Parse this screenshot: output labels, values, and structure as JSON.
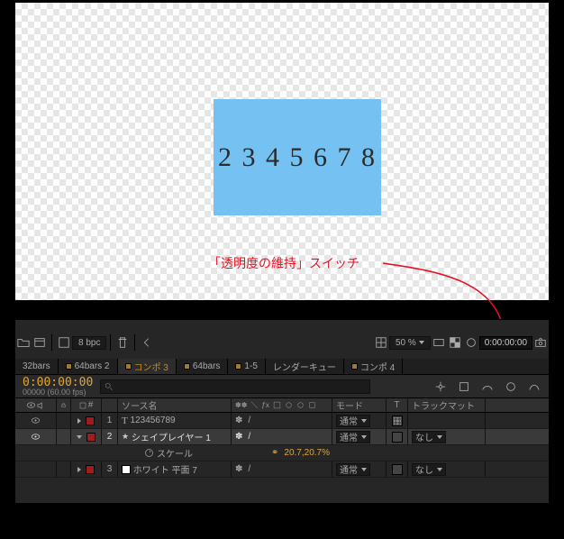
{
  "preview": {
    "numbers_visible": "2 3 4 5 6 7 8"
  },
  "annotation": {
    "text": "「透明度の維持」スイッチ"
  },
  "project_bar": {
    "bpc_label": "8 bpc",
    "zoom": "50 %",
    "timecode": "0:00:00:00"
  },
  "timeline": {
    "tabs": [
      "32bars",
      "64bars 2",
      "コンポ 3",
      "64bars",
      "1-5",
      "レンダーキュー",
      "コンポ 4"
    ],
    "selected_tab": 2,
    "timecode": "0:00:00:00",
    "frame_label": "00000 (60.00 fps)",
    "search_placeholder": "",
    "columns": {
      "source_name": "ソース名",
      "mode": "モード",
      "t": "T",
      "track_matte": "トラックマット"
    },
    "mode_value": "通常",
    "track_value": "なし",
    "layers": [
      {
        "index": 1,
        "name": "123456789",
        "type": "text",
        "color": "red",
        "visible": true,
        "mode": "通常",
        "preserve": true,
        "selected": false,
        "trk": ""
      },
      {
        "index": 2,
        "name": "シェイプレイヤー 1",
        "type": "shape",
        "color": "red",
        "visible": true,
        "mode": "通常",
        "preserve": false,
        "selected": true,
        "trk": "なし"
      },
      {
        "index": 3,
        "name": "ホワイト 平面 7",
        "type": "solid",
        "color": "white",
        "visible": false,
        "mode": "通常",
        "preserve": false,
        "selected": false,
        "trk": "なし"
      }
    ],
    "scale_label": "スケール",
    "scale_value": "20.7,20.7%"
  }
}
